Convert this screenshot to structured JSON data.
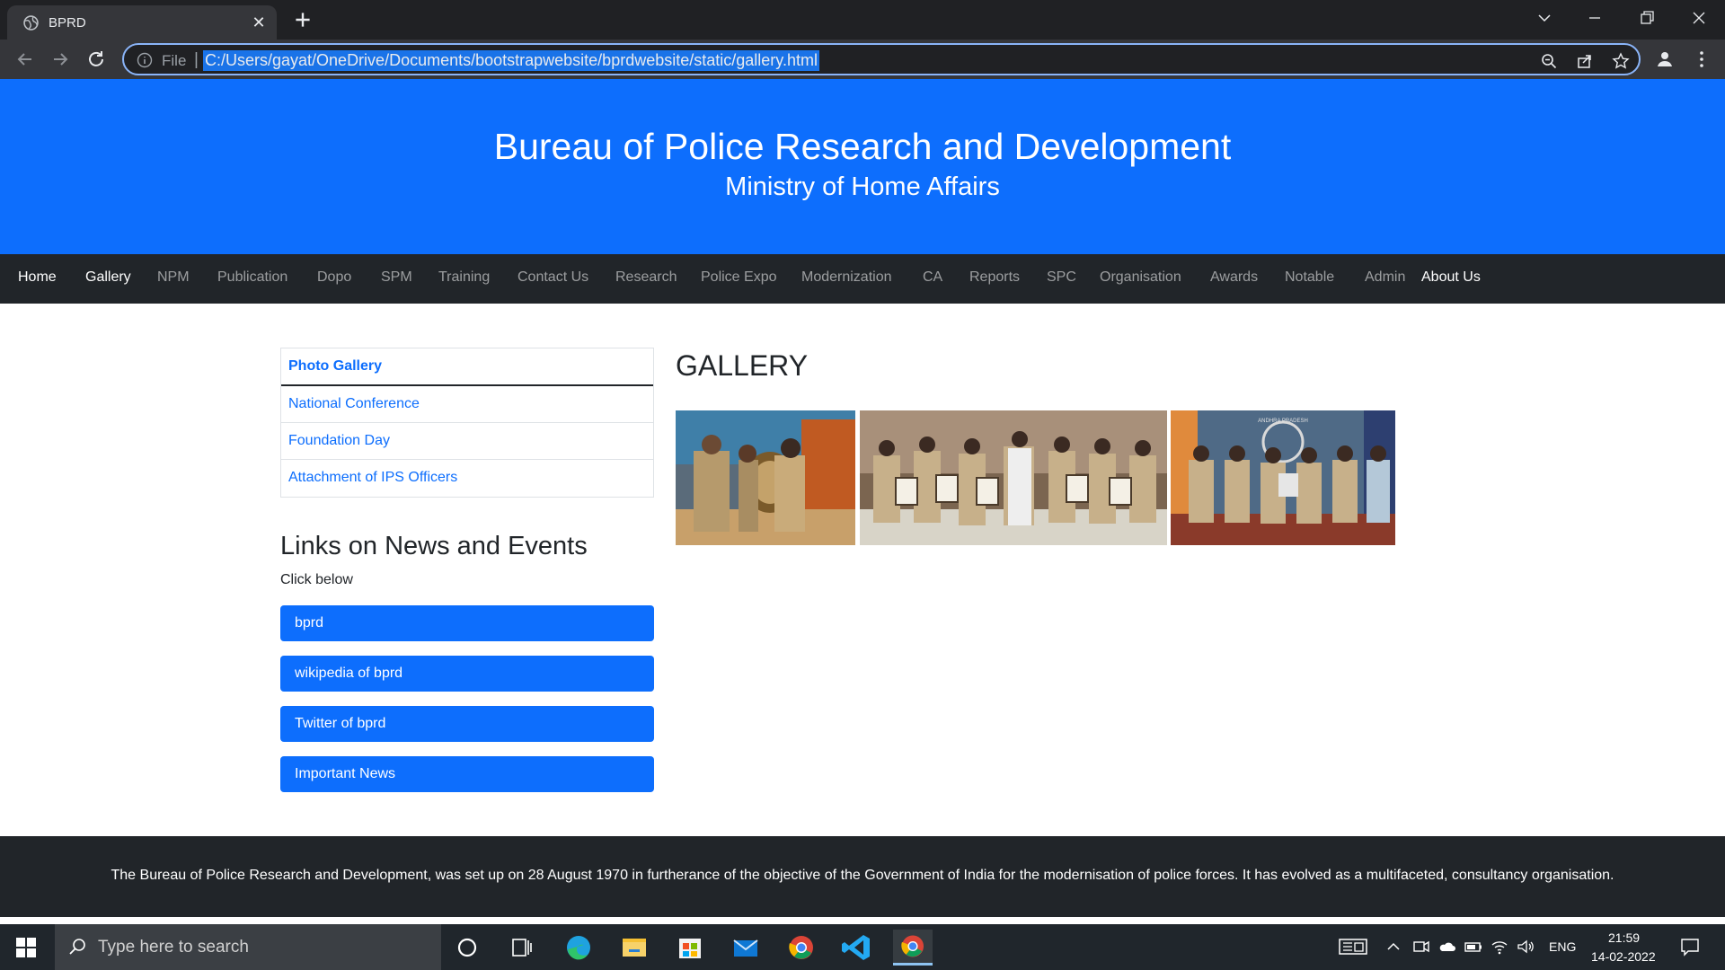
{
  "browser": {
    "tab_title": "BPRD",
    "omnibox_label": "File",
    "url": "C:/Users/gayat/OneDrive/Documents/bootstrapwebsite/bprdwebsite/static/gallery.html"
  },
  "header": {
    "title": "Bureau of Police Research and Development",
    "subtitle": "Ministry of Home Affairs"
  },
  "navbar": {
    "items": [
      {
        "label": "Home"
      },
      {
        "label": "Gallery"
      },
      {
        "label": "NPM"
      },
      {
        "label": "Publication"
      },
      {
        "label": "Dopo"
      },
      {
        "label": "SPM"
      },
      {
        "label": "Training"
      },
      {
        "label": "Contact Us"
      },
      {
        "label": "Research"
      },
      {
        "label": "Police Expo"
      },
      {
        "label": "Modernization"
      },
      {
        "label": "CA"
      },
      {
        "label": "Reports"
      },
      {
        "label": "SPC"
      },
      {
        "label": "Organisation"
      },
      {
        "label": "Awards"
      },
      {
        "label": "Notable"
      },
      {
        "label": "Admin"
      },
      {
        "label": "About Us"
      }
    ]
  },
  "sidebar": {
    "items": [
      {
        "label": "Photo Gallery"
      },
      {
        "label": "National Conference"
      },
      {
        "label": "Foundation Day"
      },
      {
        "label": "Attachment of IPS Officers"
      }
    ]
  },
  "links": {
    "title": "Links on News and Events",
    "subtitle": "Click below",
    "buttons": [
      {
        "label": "bprd"
      },
      {
        "label": "wikipedia of bprd"
      },
      {
        "label": "Twitter of bprd"
      },
      {
        "label": "Important News"
      }
    ]
  },
  "gallery": {
    "title": "GALLERY",
    "photo3_caption": "ANDHRA PRADESH"
  },
  "footer": {
    "text": "The Bureau of Police Research and Development, was set up on 28 August 1970 in furtherance of the objective of the Government of India for the modernisation of police forces. It has evolved as a multifaceted, consultancy organisation."
  },
  "taskbar": {
    "search_placeholder": "Type here to search",
    "language": "ENG",
    "time": "21:59",
    "date": "14-02-2022"
  },
  "colors": {
    "primary": "#0d6efd",
    "dark": "#212529",
    "chrome_bg": "#202124",
    "taskbar_bg": "#20262c"
  }
}
